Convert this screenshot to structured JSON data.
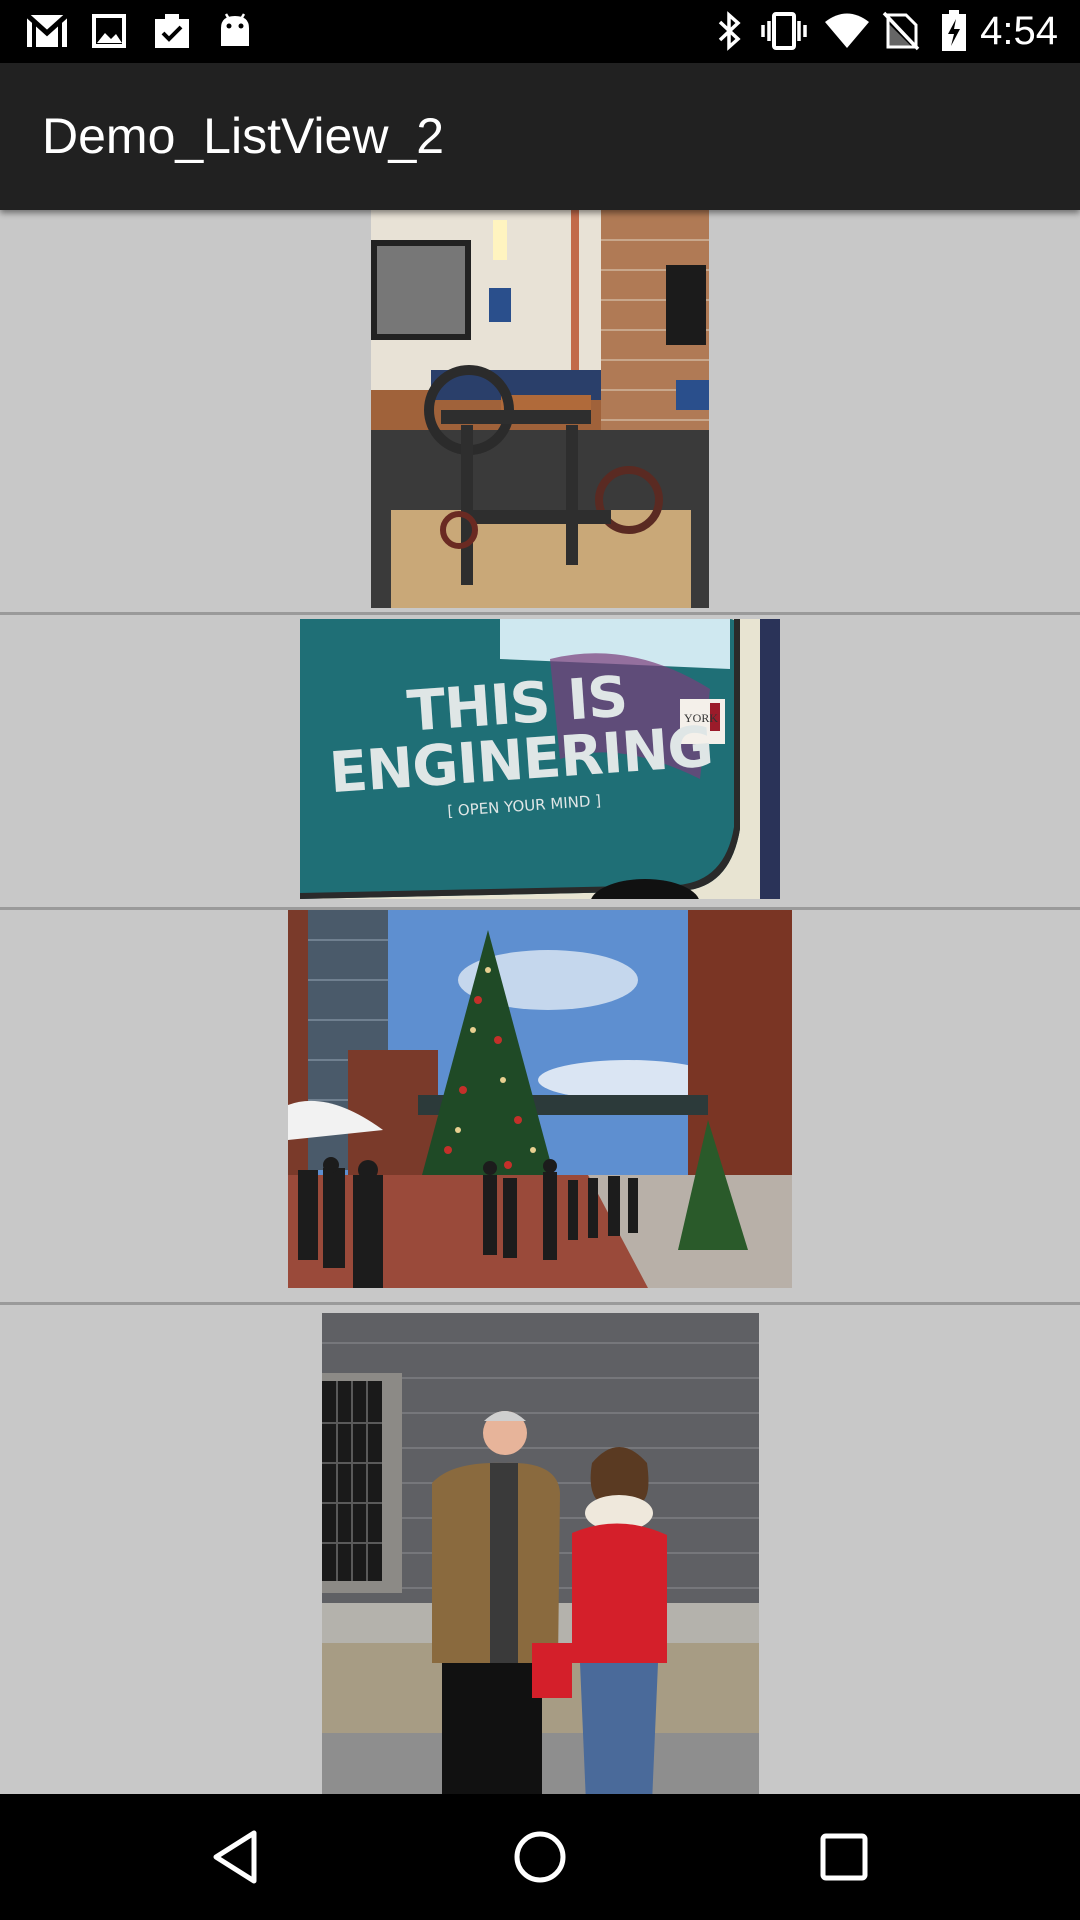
{
  "status_bar": {
    "time": "4:54",
    "left_icons": [
      "gmail-icon",
      "gallery-icon",
      "clipboard-check-icon",
      "android-icon"
    ],
    "right_icons": [
      "bluetooth-icon",
      "vibrate-icon",
      "wifi-icon",
      "no-sim-icon",
      "battery-charging-icon"
    ]
  },
  "app_bar": {
    "title": "Demo_ListView_2",
    "background": "#212121"
  },
  "list": {
    "background": "#c8c8c8",
    "divider_color": "#9a9a9a",
    "items": [
      {
        "name": "photo-printing-press",
        "sign_text": ""
      },
      {
        "name": "photo-engineering-ad",
        "sign_text": "THIS IS ENGINERING",
        "sign_subtext": "[ OPEN YOUR MIND ]",
        "logo_text": "YORK"
      },
      {
        "name": "photo-christmas-tree-market",
        "sign_text": ""
      },
      {
        "name": "photo-couple-stone-wall",
        "sign_text": ""
      }
    ]
  },
  "nav_bar": {
    "buttons": [
      "back-icon",
      "home-icon",
      "recents-icon"
    ]
  }
}
